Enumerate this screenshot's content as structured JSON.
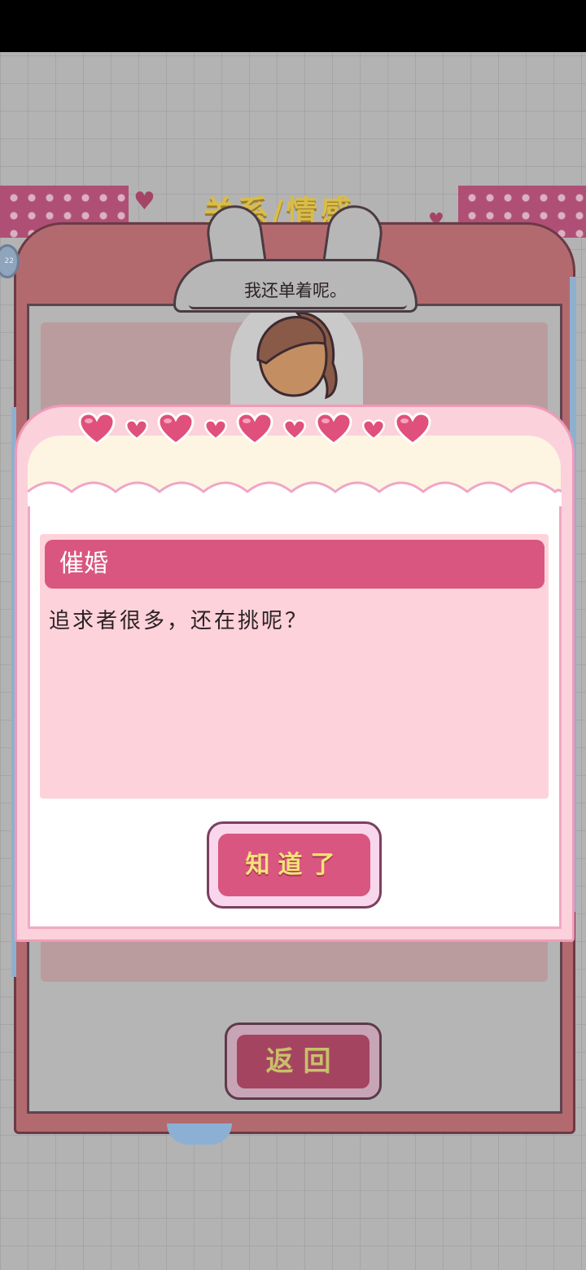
{
  "status_bar": {},
  "background_screen": {
    "title_peek": "关系/情感",
    "side_badge": "22",
    "speech_bubble": "我还单着呢。",
    "return_button": "返回"
  },
  "modal": {
    "title": "催婚",
    "message": "追求者很多，还在挑呢？",
    "ok_button": "知道了",
    "hearts": [
      "big",
      "small",
      "big",
      "small",
      "big",
      "small",
      "big",
      "small",
      "big"
    ]
  },
  "colors": {
    "accent_pink": "#d95680",
    "card_pink": "#fed2da",
    "button_text_yellow": "#f7e27a"
  }
}
